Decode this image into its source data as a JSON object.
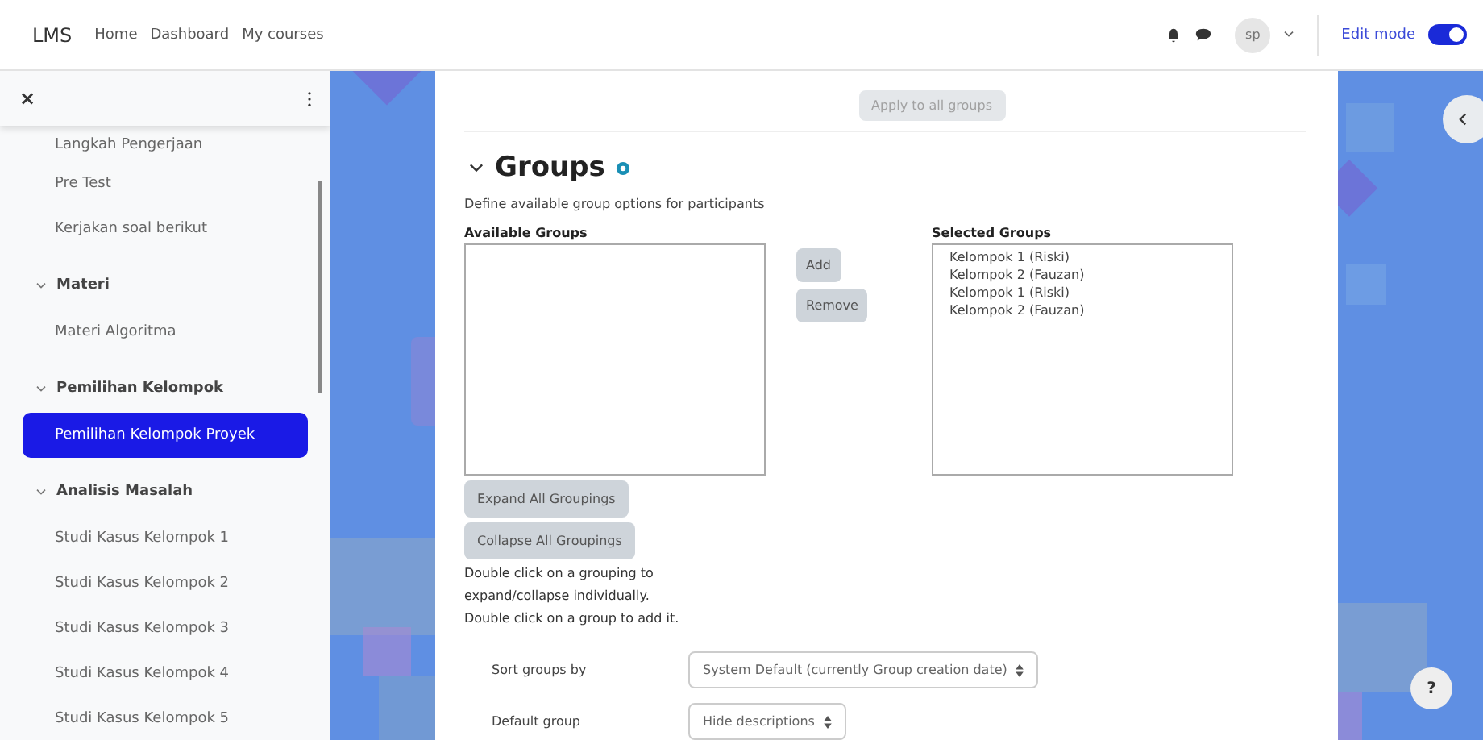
{
  "navbar": {
    "brand": "LMS",
    "links": [
      "Home",
      "Dashboard",
      "My courses"
    ],
    "avatar": "sp",
    "edit_mode": {
      "label": "Edit mode",
      "on": true
    }
  },
  "sidebar": {
    "close": "×",
    "items": [
      {
        "kind": "item",
        "label": "Langkah Pengerjaan",
        "selected": false
      },
      {
        "kind": "item",
        "label": "Pre Test",
        "selected": false
      },
      {
        "kind": "item",
        "label": "Kerjakan soal berikut",
        "selected": false
      },
      {
        "kind": "section",
        "label": "Materi",
        "expanded": true,
        "children": [
          {
            "label": "Materi Algoritma",
            "selected": false
          }
        ]
      },
      {
        "kind": "section",
        "label": "Pemilihan Kelompok",
        "expanded": true,
        "children": [
          {
            "label": "Pemilihan Kelompok Proyek",
            "selected": true
          }
        ]
      },
      {
        "kind": "section",
        "label": "Analisis Masalah",
        "expanded": true,
        "children": [
          {
            "label": "Studi Kasus Kelompok 1",
            "selected": false
          },
          {
            "label": "Studi Kasus Kelompok 2",
            "selected": false
          },
          {
            "label": "Studi Kasus Kelompok 3",
            "selected": false
          },
          {
            "label": "Studi Kasus Kelompok 4",
            "selected": false
          },
          {
            "label": "Studi Kasus Kelompok 5",
            "selected": false
          }
        ]
      }
    ]
  },
  "main": {
    "apply_button": "Apply to all groups",
    "section": {
      "title": "Groups",
      "expanded": true
    },
    "description": "Define available group options for participants",
    "available": {
      "label": "Available Groups"
    },
    "add_button": "Add",
    "remove_button": "Remove",
    "selected": {
      "label": "Selected Groups",
      "options": [
        "Kelompok 1 (Riski)",
        "Kelompok 2 (Fauzan)",
        "Kelompok 1 (Riski)",
        "Kelompok 2 (Fauzan)"
      ]
    },
    "expand_button": "Expand All Groupings",
    "collapse_button": "Collapse All Groupings",
    "help_lines": [
      "Double click on a grouping to",
      "expand/collapse individually.",
      "Double click on a group to add it."
    ],
    "settings": [
      {
        "label": "Sort groups by",
        "value": "System Default (currently Group creation date)"
      },
      {
        "label": "Default group",
        "value": "Hide descriptions"
      }
    ]
  },
  "help_button": "?"
}
